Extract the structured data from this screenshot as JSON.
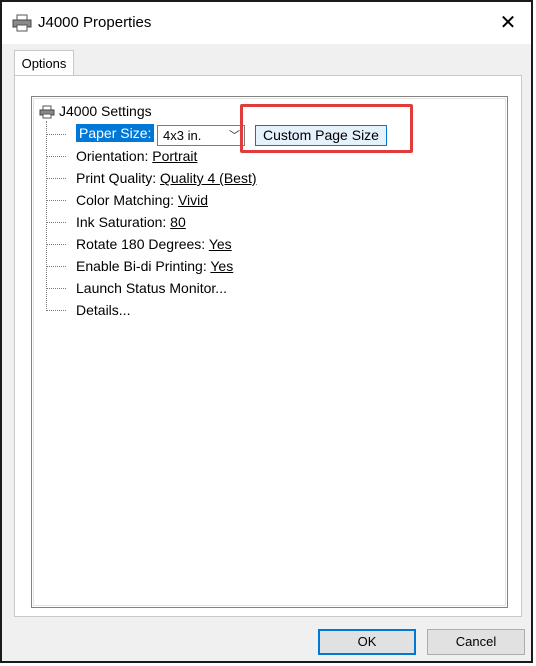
{
  "window": {
    "title": "J4000 Properties",
    "close_glyph": "✕"
  },
  "tabs": [
    {
      "label": "Options"
    }
  ],
  "tree": {
    "root_label": "J4000 Settings",
    "items": [
      {
        "label": "Paper Size:",
        "value": ""
      },
      {
        "label": "Orientation: ",
        "value": "Portrait"
      },
      {
        "label": "Print Quality: ",
        "value": "Quality 4 (Best)"
      },
      {
        "label": "Color Matching: ",
        "value": "Vivid"
      },
      {
        "label": "Ink Saturation: ",
        "value": "80"
      },
      {
        "label": "Rotate 180 Degrees: ",
        "value": "Yes"
      },
      {
        "label": "Enable Bi-di Printing: ",
        "value": "Yes"
      },
      {
        "label": "Launch Status Monitor...",
        "value": ""
      },
      {
        "label": "Details...",
        "value": ""
      }
    ],
    "paper_size_combo": {
      "selected": "4x3 in.",
      "arrow": "﹀"
    },
    "custom_page_size_button": "Custom Page Size"
  },
  "buttons": {
    "ok": "OK",
    "cancel": "Cancel"
  },
  "colors": {
    "accent": "#0078d7",
    "highlight": "#e03c3c"
  },
  "icons": {
    "title": "printer-icon",
    "tree_root": "printer-icon"
  }
}
